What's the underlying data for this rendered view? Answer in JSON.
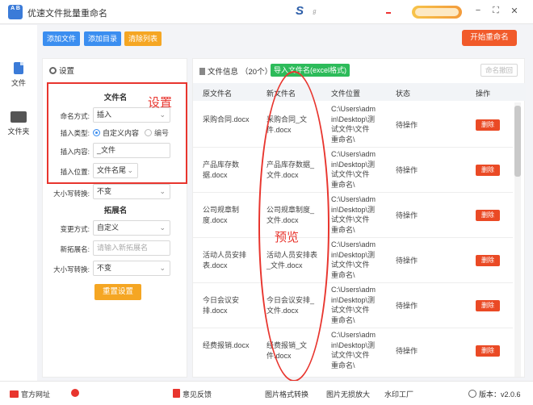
{
  "app": {
    "title": "优速文件批量重命名",
    "logo_text": "A B",
    "brand_letter": "S",
    "brand_suffix": "ℊ"
  },
  "window": {
    "minimize": "−",
    "restore": "⛶",
    "close": "✕"
  },
  "sidebar": {
    "items": [
      {
        "label": "文件",
        "icon": "file-icon"
      },
      {
        "label": "文件夹",
        "icon": "folder-icon"
      }
    ]
  },
  "toolbar": {
    "add_file": "添加文件",
    "add_folder": "添加目录",
    "clear_list": "清除列表",
    "start": "开始重命名"
  },
  "settings": {
    "title": "设置",
    "filename_section": "文件名",
    "rename_mode_label": "命名方式:",
    "rename_mode_value": "插入",
    "insert_type_label": "插入类型:",
    "insert_type_custom": "自定义内容",
    "insert_type_number": "编号",
    "insert_content_label": "插入内容:",
    "insert_content_value": "_文件",
    "insert_pos_label": "插入位置:",
    "insert_pos_value": "文件名尾",
    "case_label": "大小写转换:",
    "case_value": "不变",
    "ext_section": "拓展名",
    "ext_mode_label": "变更方式:",
    "ext_mode_value": "自定义",
    "new_ext_label": "新拓展名:",
    "new_ext_placeholder": "请输入新拓展名",
    "ext_case_label": "大小写转换:",
    "ext_case_value": "不变",
    "reset": "重置设置"
  },
  "annotations": {
    "settings_note": "设置",
    "preview_note": "预览"
  },
  "fileinfo": {
    "title": "文件信息",
    "count": "（20个）",
    "import_button": "导入文件名(excel格式)",
    "rollback_button": "命名撤回",
    "columns": {
      "orig": "原文件名",
      "new": "新文件名",
      "loc": "文件位置",
      "status": "状态",
      "action": "操作"
    },
    "rows": [
      {
        "orig": "采购合同.docx",
        "new": "采购合同_文件.docx",
        "loc": "C:\\Users\\admin\\Desktop\\测试文件\\文件重命名\\",
        "status": "待操作",
        "action": "删除"
      },
      {
        "orig": "产品库存数据.docx",
        "new": "产品库存数据_文件.docx",
        "loc": "C:\\Users\\admin\\Desktop\\测试文件\\文件重命名\\",
        "status": "待操作",
        "action": "删除"
      },
      {
        "orig": "公司规章制度.docx",
        "new": "公司规章制度_文件.docx",
        "loc": "C:\\Users\\admin\\Desktop\\测试文件\\文件重命名\\",
        "status": "待操作",
        "action": "删除"
      },
      {
        "orig": "活动人员安排表.docx",
        "new": "活动人员安排表_文件.docx",
        "loc": "C:\\Users\\admin\\Desktop\\测试文件\\文件重命名\\",
        "status": "待操作",
        "action": "删除"
      },
      {
        "orig": "今日会议安排.docx",
        "new": "今日会议安排_文件.docx",
        "loc": "C:\\Users\\admin\\Desktop\\测试文件\\文件重命名\\",
        "status": "待操作",
        "action": "删除"
      },
      {
        "orig": "经费报销.docx",
        "new": "经费报销_文件.docx",
        "loc": "C:\\Users\\admin\\Desktop\\测试文件\\文件重命名\\",
        "status": "待操作",
        "action": "删除"
      }
    ]
  },
  "footer": {
    "website": "官方网址",
    "support": "",
    "feedback": "意见反馈",
    "img_convert": "图片格式转换",
    "img_enlarge": "图片无损放大",
    "watermark": "水印工厂",
    "version_label": "版本：",
    "version": "v2.0.6"
  },
  "colors": {
    "accent_blue": "#3b8ef0",
    "orange": "#f5a623",
    "start_red": "#f15a2a",
    "import_green": "#2dbb5a",
    "delete_red": "#ea4a25",
    "annotation_red": "#e8352e"
  }
}
